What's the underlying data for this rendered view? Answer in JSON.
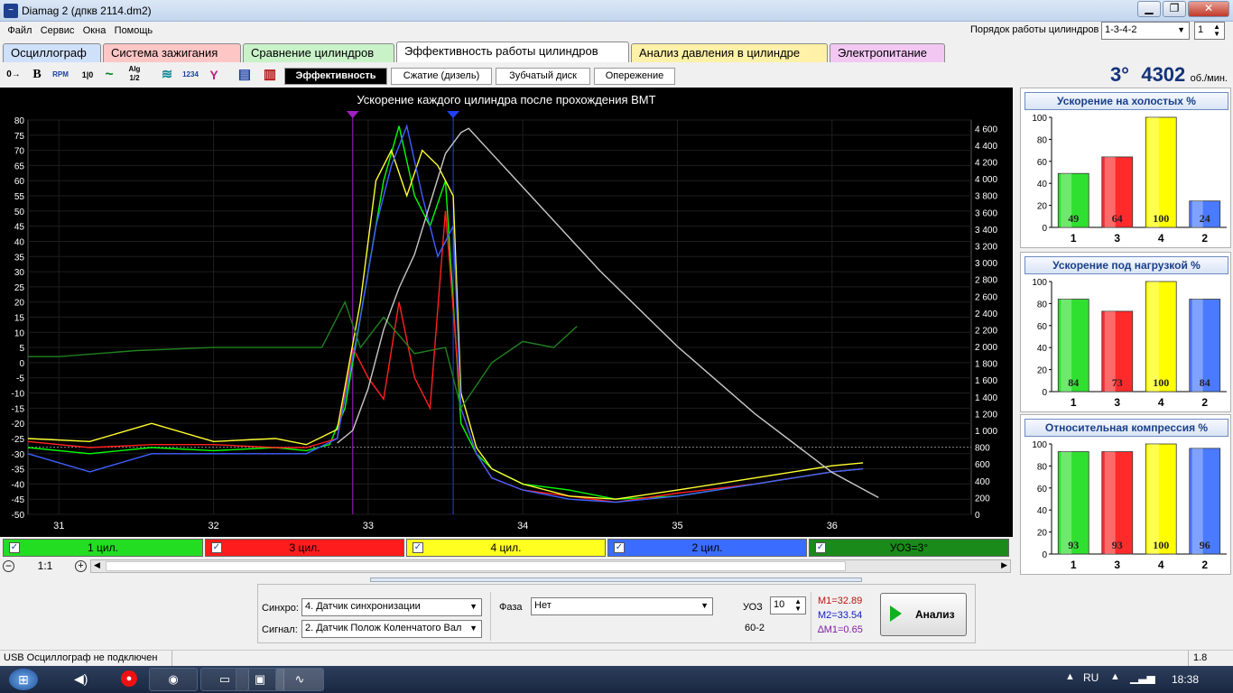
{
  "window": {
    "title": "Diamag 2 (дпкв 2114.dm2)",
    "minimize": "▁",
    "maximize": "❐",
    "close": "✕",
    "cyl_order_label": "Порядок работы цилиндров",
    "cyl_order_value": "1-3-4-2",
    "cyl_index_value": "1"
  },
  "menu": [
    "Файл",
    "Сервис",
    "Окна",
    "Помощь"
  ],
  "tabs": [
    {
      "label": "Осциллограф",
      "color": "#cfe0fb"
    },
    {
      "label": "Система зажигания",
      "color": "#ffc6c6"
    },
    {
      "label": "Сравнение цилиндров",
      "color": "#c9f2c9"
    },
    {
      "label": "Эффективность работы цилиндров",
      "color": "#ffffff"
    },
    {
      "label": "Анализ давления в цилиндре",
      "color": "#fff1a8"
    },
    {
      "label": "Электропитание",
      "color": "#f2c8f2"
    }
  ],
  "toolbar": {
    "icons": [
      "0→",
      "B",
      "RPM",
      "1|0",
      "~",
      "Alg 1/2",
      "≋",
      "1234",
      "Y",
      "▤",
      "▥"
    ],
    "subtabs": [
      "Эффективность",
      "Сжатие (дизель)",
      "Зубчатый диск",
      "Опережение"
    ]
  },
  "rpm": {
    "deg": "3°",
    "value": "4302",
    "unit": "об./мин."
  },
  "chart_data": {
    "type": "line",
    "title": "Ускорение каждого цилиндра после прохождения ВМТ",
    "x_ticks": [
      "31",
      "32",
      "33",
      "34",
      "35",
      "36"
    ],
    "x_range": [
      30.8,
      36.9
    ],
    "y_left_ticks": [
      "80",
      "75",
      "70",
      "65",
      "60",
      "55",
      "50",
      "45",
      "40",
      "35",
      "30",
      "25",
      "20",
      "15",
      "10",
      "5",
      "0",
      "-5",
      "-10",
      "-15",
      "-20",
      "-25",
      "-30",
      "-35",
      "-40",
      "-45",
      "-50"
    ],
    "y_left_range": [
      -50,
      80
    ],
    "y_right_ticks": [
      "4 600",
      "4 400",
      "4 200",
      "4 000",
      "3 800",
      "3 600",
      "3 400",
      "3 200",
      "3 000",
      "2 800",
      "2 600",
      "2 400",
      "2 200",
      "2 000",
      "1 800",
      "1 600",
      "1 400",
      "1 200",
      "1 000",
      "800",
      "600",
      "400",
      "200",
      "0"
    ],
    "y_right_range": [
      0,
      4700
    ],
    "markers": [
      {
        "x": 32.9,
        "color": "#a020c0"
      },
      {
        "x": 33.55,
        "color": "#2040ff"
      }
    ],
    "series": [
      {
        "name": "1 цил.",
        "color": "#00ff00",
        "x": [
          30.8,
          31.2,
          31.6,
          32.0,
          32.4,
          32.6,
          32.75,
          32.85,
          33.0,
          33.1,
          33.2,
          33.3,
          33.4,
          33.5,
          33.6,
          33.7,
          33.8,
          34.0,
          34.3,
          34.6,
          35.0,
          35.5,
          36.0,
          36.2
        ],
        "y": [
          -28,
          -30,
          -28,
          -29,
          -28,
          -29,
          -27,
          -15,
          30,
          60,
          78,
          55,
          45,
          60,
          -20,
          -30,
          -35,
          -40,
          -42,
          -45,
          -44,
          -40,
          -36,
          -35
        ]
      },
      {
        "name": "3 цил.",
        "color": "#ff2020",
        "x": [
          30.8,
          31.2,
          31.6,
          32.0,
          32.4,
          32.6,
          32.8,
          32.9,
          33.0,
          33.1,
          33.2,
          33.3,
          33.4,
          33.5,
          33.6,
          33.7,
          33.8,
          34.0,
          34.3,
          34.6,
          35.0,
          35.5,
          36.0,
          36.2
        ],
        "y": [
          -26,
          -28,
          -27,
          -27,
          -28,
          -28,
          -25,
          5,
          -5,
          -12,
          20,
          -5,
          -15,
          50,
          -15,
          -30,
          -38,
          -42,
          -44,
          -46,
          -43,
          -40,
          -36,
          -35
        ]
      },
      {
        "name": "4 цил.",
        "color": "#ffff30",
        "x": [
          30.8,
          31.2,
          31.6,
          32.0,
          32.4,
          32.6,
          32.8,
          32.95,
          33.05,
          33.15,
          33.25,
          33.35,
          33.45,
          33.55,
          33.6,
          33.7,
          33.8,
          34.0,
          34.3,
          34.6,
          35.0,
          35.5,
          36.0,
          36.2
        ],
        "y": [
          -25,
          -26,
          -20,
          -26,
          -25,
          -27,
          -22,
          20,
          60,
          70,
          55,
          70,
          65,
          55,
          -10,
          -28,
          -35,
          -40,
          -44,
          -45,
          -42,
          -38,
          -34,
          -33
        ]
      },
      {
        "name": "2 цил.",
        "color": "#4060ff",
        "x": [
          30.8,
          31.2,
          31.6,
          32.0,
          32.4,
          32.6,
          32.8,
          32.95,
          33.05,
          33.15,
          33.25,
          33.35,
          33.45,
          33.55,
          33.6,
          33.7,
          33.8,
          34.0,
          34.3,
          34.6,
          35.0,
          35.5,
          36.0,
          36.2
        ],
        "y": [
          -30,
          -36,
          -30,
          -30,
          -30,
          -30,
          -25,
          15,
          45,
          65,
          78,
          55,
          35,
          45,
          -15,
          -30,
          -38,
          -42,
          -45,
          -46,
          -44,
          -40,
          -36,
          -35
        ]
      },
      {
        "name": "УОЗ=3°",
        "color": "#208020",
        "x": [
          30.8,
          31.0,
          31.5,
          32.0,
          32.5,
          32.7,
          32.85,
          32.95,
          33.1,
          33.3,
          33.5,
          33.6,
          33.8,
          34.0,
          34.2,
          34.35
        ],
        "y": [
          2,
          2,
          4,
          5,
          5,
          5,
          20,
          5,
          15,
          3,
          5,
          -15,
          0,
          7,
          5,
          12
        ]
      },
      {
        "name": "RPM",
        "color": "#c8c8c8",
        "axis": "right",
        "x": [
          32.8,
          32.9,
          33.0,
          33.1,
          33.2,
          33.3,
          33.4,
          33.5,
          33.6,
          33.65,
          33.8,
          34.0,
          34.5,
          35.0,
          35.5,
          36.0,
          36.2,
          36.3
        ],
        "y": [
          850,
          1000,
          1500,
          2200,
          2700,
          3100,
          3700,
          4300,
          4550,
          4600,
          4300,
          3900,
          2900,
          2000,
          1200,
          500,
          300,
          200
        ]
      }
    ]
  },
  "legend": [
    {
      "label": "1 цил.",
      "color": "#22dd22"
    },
    {
      "label": "3 цил.",
      "color": "#ff1c1c"
    },
    {
      "label": "4 цил.",
      "color": "#ffff20"
    },
    {
      "label": "2 цил.",
      "color": "#3a6cff"
    },
    {
      "label": "УОЗ=3°",
      "color": "#1a8a1a"
    }
  ],
  "zoom": "1:1",
  "side_panels": [
    {
      "title": "Ускорение на холостых %",
      "categories": [
        "1",
        "3",
        "4",
        "2"
      ],
      "values": [
        49,
        64,
        100,
        24
      ],
      "ticks": [
        "100",
        "80",
        "60",
        "40",
        "20",
        "0"
      ]
    },
    {
      "title": "Ускорение под нагрузкой %",
      "categories": [
        "1",
        "3",
        "4",
        "2"
      ],
      "values": [
        84,
        73,
        100,
        84
      ],
      "ticks": [
        "100",
        "80",
        "60",
        "40",
        "20",
        "0"
      ]
    },
    {
      "title": "Относительная компрессия %",
      "categories": [
        "1",
        "3",
        "4",
        "2"
      ],
      "values": [
        93,
        93,
        100,
        96
      ],
      "ticks": [
        "100",
        "80",
        "60",
        "40",
        "20",
        "0"
      ]
    }
  ],
  "bar_colors": [
    "#30e030",
    "#ff2a2a",
    "#ffff00",
    "#4a7aff"
  ],
  "bottom": {
    "sync_label": "Синхро:",
    "sync_value": "4.  Датчик синхронизации",
    "signal_label": "Сигнал:",
    "signal_value": "2.  Датчик Полож Коленчатого Вал",
    "phase_label": "Фаза",
    "phase_value": "Нет",
    "uoz_label": "УОЗ",
    "uoz_value": "10",
    "gear_text": "60-2",
    "m1": "M1=32.89",
    "m2": "M2=33.54",
    "dm1": "∆M1=0.65",
    "analyze": "Анализ"
  },
  "status": {
    "text": "USB Осциллограф не подключен",
    "version": "1.8"
  },
  "taskbar": {
    "lang": "RU",
    "time": "18:38"
  }
}
